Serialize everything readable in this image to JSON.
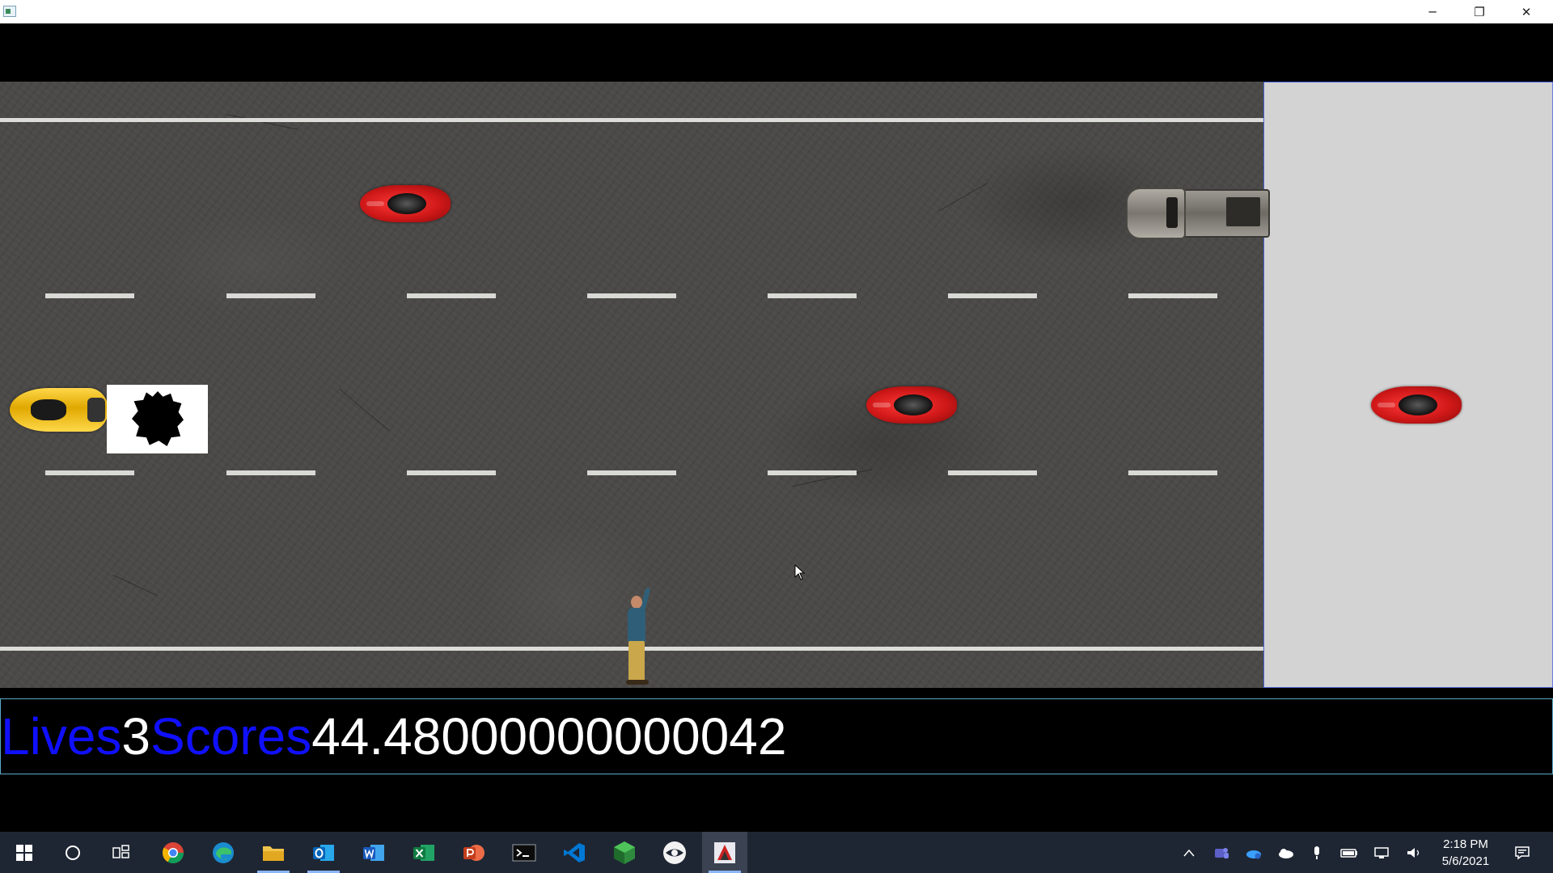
{
  "window": {
    "app_icon": "app-icon",
    "controls": {
      "minimize": "─",
      "restore": "❐",
      "close": "✕"
    }
  },
  "game": {
    "objects": [
      "red-car",
      "red-car",
      "gray-pickup-truck",
      "yellow-car",
      "pothole",
      "pedestrian",
      "red-car-preview"
    ],
    "colors": {
      "road": "#4b4a48",
      "lane_marking": "#d9d9d6",
      "side_panel": "#d3d3d3"
    }
  },
  "hud": {
    "lives_label": "Lives",
    "lives_value": "3",
    "scores_label": "Scores",
    "scores_value": "44.48000000000042",
    "colors": {
      "label": "#1010ff",
      "value": "#ffffff"
    }
  },
  "taskbar": {
    "apps": [
      "start-icon",
      "search-icon",
      "task-view-icon",
      "chrome-icon",
      "edge-icon",
      "file-explorer-icon",
      "outlook-icon",
      "word-icon",
      "excel-icon",
      "powerpoint-icon",
      "terminal-icon",
      "vscode-icon",
      "green-app-icon",
      "eye-app-icon",
      "game-app-icon"
    ],
    "time": "2:18 PM",
    "date": "5/6/2021"
  }
}
